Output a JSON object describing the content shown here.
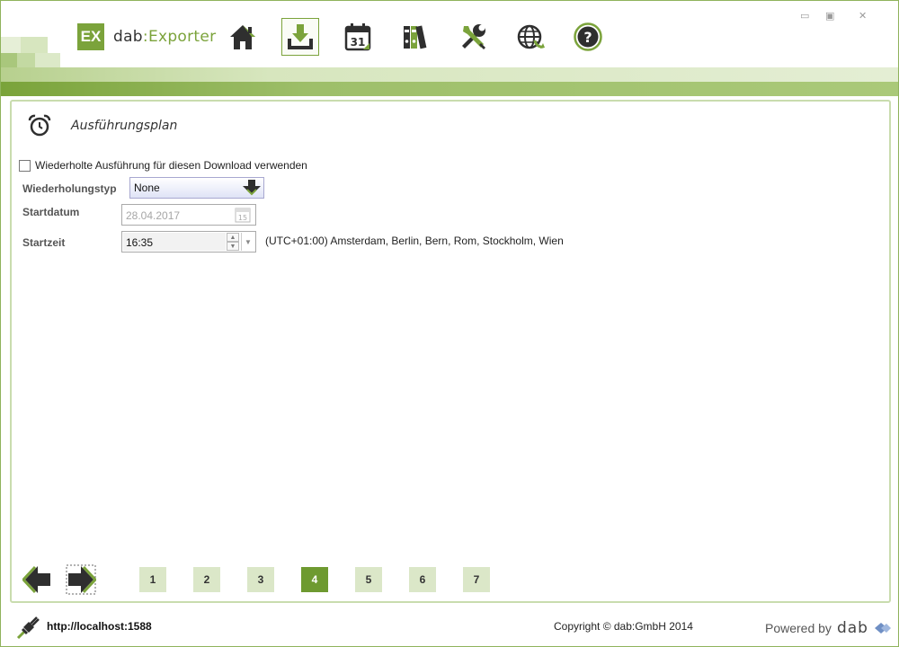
{
  "app": {
    "logo_mark": "EX",
    "logo_prefix": "dab",
    "logo_separator": ":",
    "logo_name": "Exporter",
    "brand_color": "#7ba33b"
  },
  "nav": {
    "items": [
      {
        "id": "home",
        "icon": "home-icon",
        "active": false
      },
      {
        "id": "download",
        "icon": "download-tray-icon",
        "active": true
      },
      {
        "id": "calendar",
        "icon": "calendar-icon",
        "label": "31",
        "active": false
      },
      {
        "id": "library",
        "icon": "binders-icon",
        "active": false
      },
      {
        "id": "tools",
        "icon": "tools-icon",
        "active": false
      },
      {
        "id": "globe",
        "icon": "globe-refresh-icon",
        "active": false
      },
      {
        "id": "help",
        "icon": "help-icon",
        "label": "?",
        "active": false
      }
    ]
  },
  "window_controls": {
    "minimize": "▭",
    "maximize": "▣",
    "close": "✕"
  },
  "section": {
    "icon": "alarm-clock-icon",
    "title": "Ausführungsplan"
  },
  "form": {
    "repeat_checkbox": {
      "label": "Wiederholte Ausführung für diesen Download verwenden",
      "checked": false
    },
    "repeat_type": {
      "label": "Wiederholungstyp",
      "value": "None"
    },
    "start_date": {
      "label": "Startdatum",
      "value": "28.04.2017",
      "calendar_day": "15",
      "disabled": true
    },
    "start_time": {
      "label": "Startzeit",
      "value": "16:35",
      "spin_up": "▲",
      "spin_down": "▼",
      "dropdown": "▼"
    },
    "timezone": "(UTC+01:00) Amsterdam, Berlin, Bern, Rom, Stockholm, Wien"
  },
  "steps": {
    "back_icon": "arrow-left-icon",
    "next_icon": "arrow-right-icon",
    "items": [
      "1",
      "2",
      "3",
      "4",
      "5",
      "6",
      "7"
    ],
    "active": "4"
  },
  "footer": {
    "url": "http://localhost:1588",
    "copyright": "Copyright © dab:GmbH 2014",
    "powered_label": "Powered by",
    "powered_brand": "dab"
  }
}
